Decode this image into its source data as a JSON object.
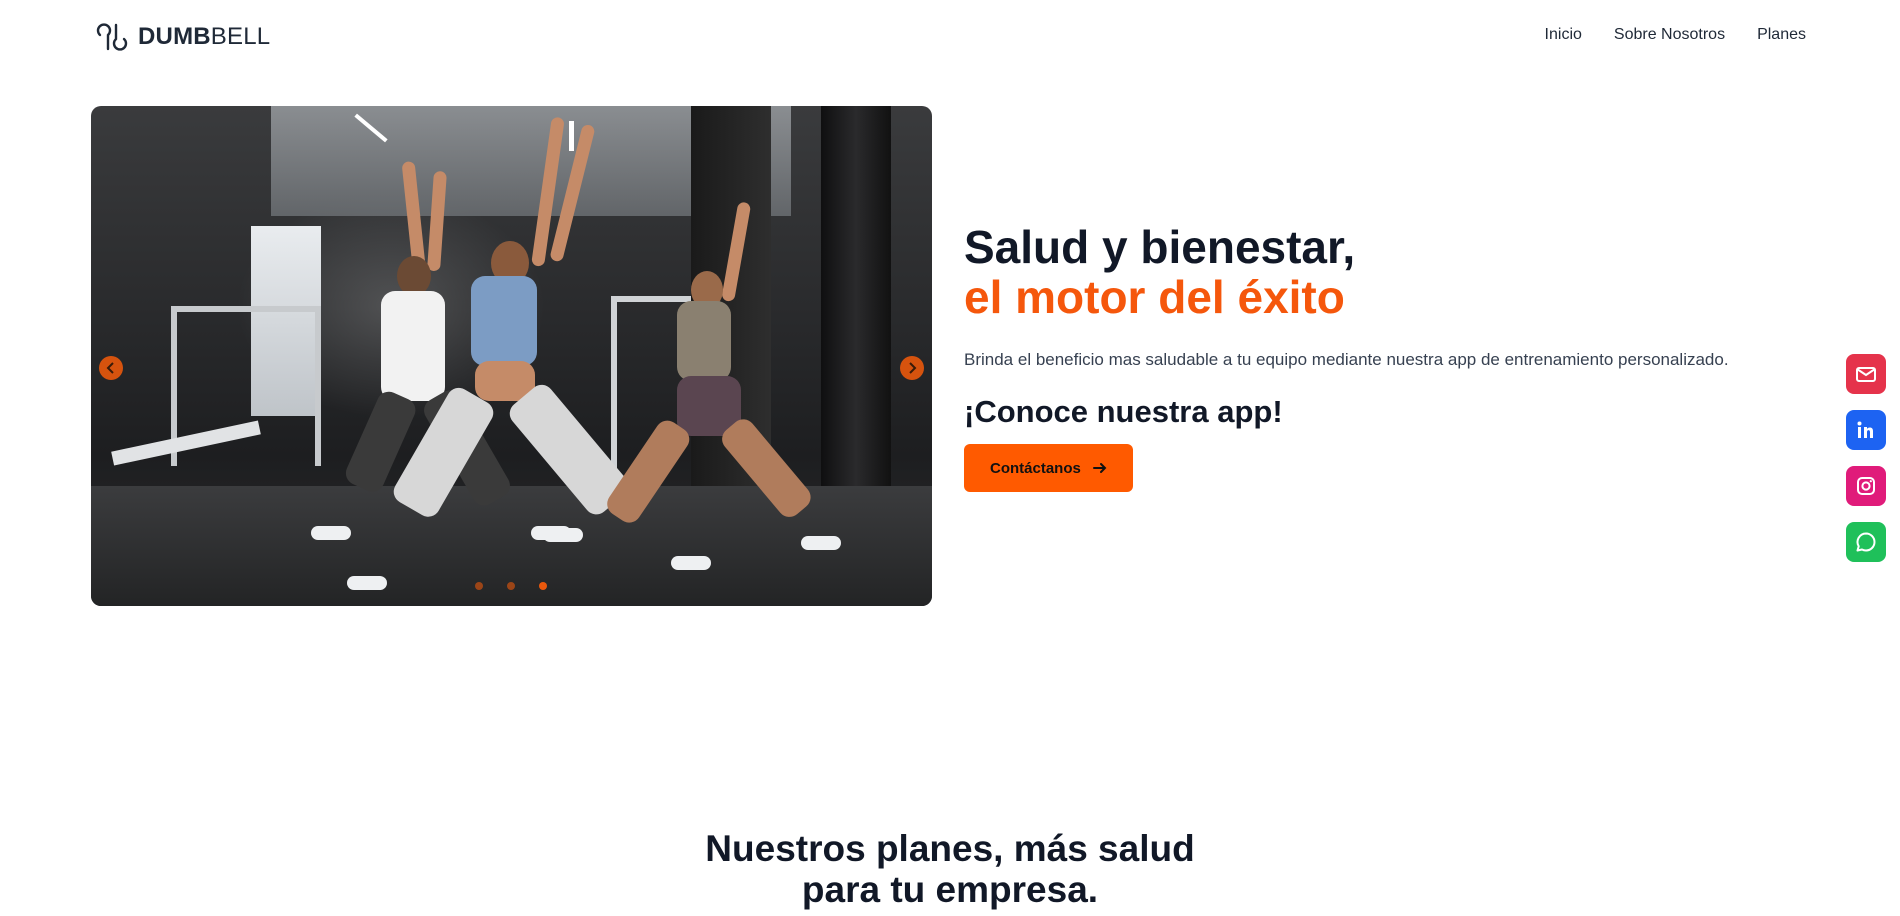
{
  "header": {
    "logo_bold": "DUMB",
    "logo_light": "BELL",
    "nav": [
      {
        "label": "Inicio"
      },
      {
        "label": "Sobre Nosotros"
      },
      {
        "label": "Planes"
      }
    ]
  },
  "hero": {
    "title_line1": "Salud y bienestar,",
    "title_line2": "el motor del éxito",
    "subtitle": "Brinda el beneficio mas saludable a tu equipo mediante nuestra app de entrenamiento personalizado.",
    "cta_heading": "¡Conoce nuestra app!",
    "cta_button": "Contáctanos",
    "carousel": {
      "slide_count": 3,
      "active_slide": 3
    }
  },
  "social": [
    {
      "icon": "mail-icon",
      "color": "#e5334b"
    },
    {
      "icon": "linkedin-icon",
      "color": "#1d63f2"
    },
    {
      "icon": "instagram-icon",
      "color": "#e01b7a"
    },
    {
      "icon": "whatsapp-icon",
      "color": "#1fc05a"
    }
  ],
  "plans": {
    "title_line1": "Nuestros planes, más salud",
    "title_line2": "para tu empresa."
  },
  "colors": {
    "accent": "#f5570c",
    "text": "#111827"
  }
}
